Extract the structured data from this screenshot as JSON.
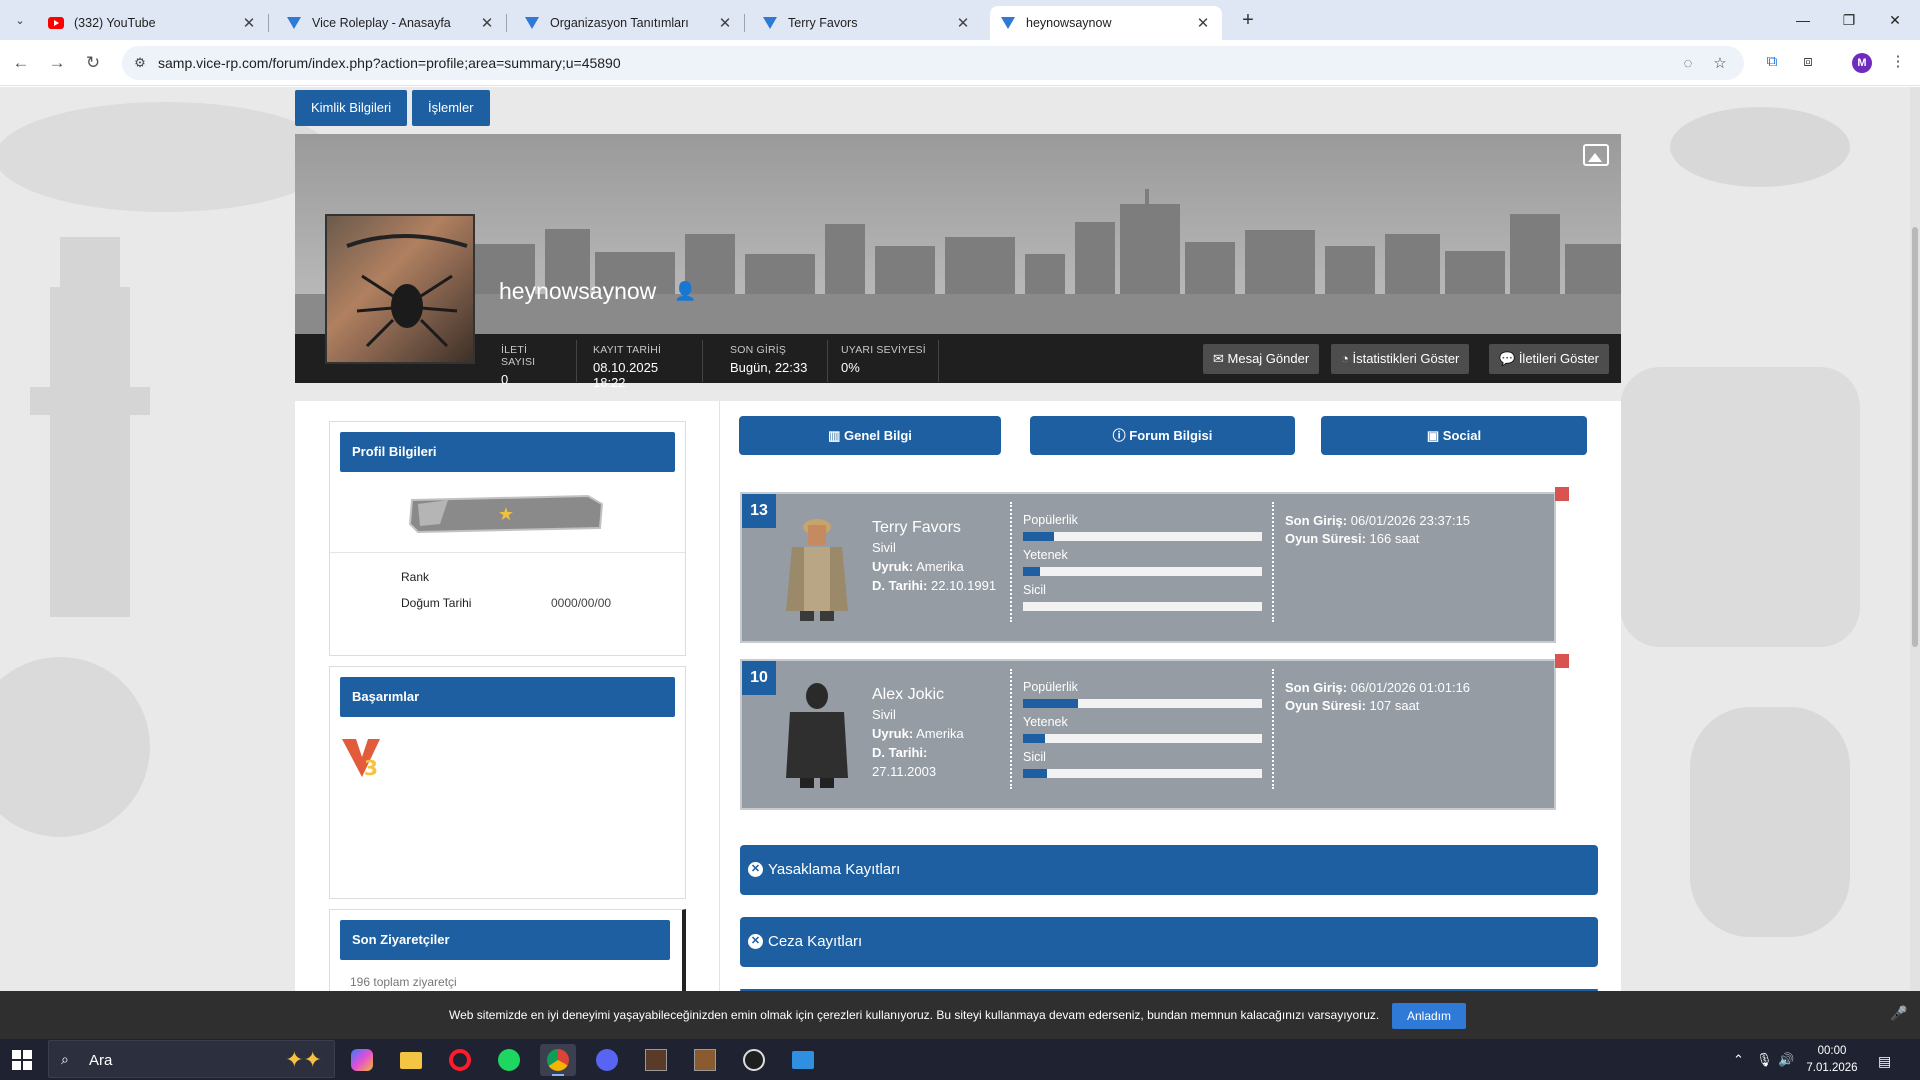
{
  "browser": {
    "tabs": [
      {
        "title": "(332) YouTube",
        "icon": "youtube-icon"
      },
      {
        "title": "Vice Roleplay - Anasayfa",
        "icon": "vice-icon"
      },
      {
        "title": "Organizasyon Tanıtımları",
        "icon": "vice-icon"
      },
      {
        "title": "Terry Favors",
        "icon": "vice-icon"
      },
      {
        "title": "heynowsaynow",
        "icon": "vice-icon",
        "active": true
      }
    ],
    "url": "samp.vice-rp.com/forum/index.php?action=profile;area=summary;u=45890",
    "profile_initial": "M"
  },
  "profile": {
    "nav_tabs": [
      "Kimlik Bilgileri",
      "İşlemler"
    ],
    "username": "heynowsaynow",
    "stats": [
      {
        "label": "İLETİ SAYISI",
        "value": "0"
      },
      {
        "label": "KAYIT TARİHİ",
        "value": "08.10.2025 18:22"
      },
      {
        "label": "SON GİRİŞ",
        "value": "Bugün, 22:33"
      },
      {
        "label": "UYARI SEVİYESİ",
        "value": "0%"
      }
    ],
    "buttons": {
      "message": "Mesaj Gönder",
      "stats": "İstatistikleri Göster",
      "posts": "İletileri Göster"
    }
  },
  "sidebar": {
    "profile_info_title": "Profil Bilgileri",
    "rank_label": "Rank",
    "birth_label": "Doğum Tarihi",
    "birth_value": "0000/00/00",
    "achievements_title": "Başarımlar",
    "visitors_title": "Son Ziyaretçiler",
    "visitors_count": "196 toplam ziyaretçi"
  },
  "info_tabs": [
    "Genel Bilgi",
    "Forum Bilgisi",
    "Social"
  ],
  "characters": [
    {
      "num": "13",
      "name": "Terry Favors",
      "status": "Sivil",
      "nationality_label": "Uyruk:",
      "nationality": "Amerika",
      "dob_label": "D. Tarihi:",
      "dob": "22.10.1991",
      "bars": [
        {
          "label": "Popülerlik",
          "value": 0.13
        },
        {
          "label": "Yetenek",
          "value": 0.07
        },
        {
          "label": "Sicil",
          "value": 0.0
        }
      ],
      "last_login_label": "Son Giriş:",
      "last_login": "06/01/2026 23:37:15",
      "playtime_label": "Oyun Süresi:",
      "playtime": "166 saat"
    },
    {
      "num": "10",
      "name": "Alex Jokic",
      "status": "Sivil",
      "nationality_label": "Uyruk:",
      "nationality": "Amerika",
      "dob_label": "D. Tarihi:",
      "dob": "27.11.2003",
      "bars": [
        {
          "label": "Popülerlik",
          "value": 0.23
        },
        {
          "label": "Yetenek",
          "value": 0.09
        },
        {
          "label": "Sicil",
          "value": 0.1
        }
      ],
      "last_login_label": "Son Giriş:",
      "last_login": "06/01/2026 01:01:16",
      "playtime_label": "Oyun Süresi:",
      "playtime": "107 saat"
    }
  ],
  "records": [
    "Yasaklama Kayıtları",
    "Ceza Kayıtları"
  ],
  "cookie": {
    "text": "Web sitemizde en iyi deneyimi yaşayabileceğinizden emin olmak için çerezleri kullanıyoruz. Bu siteyi kullanmaya devam ederseniz, bundan memnun kalacağınızı varsayıyoruz.",
    "button": "Anladım"
  },
  "taskbar": {
    "search_label": "Ara",
    "time": "00:00",
    "date": "7.01.2026"
  },
  "colors": {
    "primary_blue": "#1d5fa1",
    "stat_bar": "#1f1f1f",
    "char_card": "#959ca4",
    "flag_red": "#d9534f"
  }
}
